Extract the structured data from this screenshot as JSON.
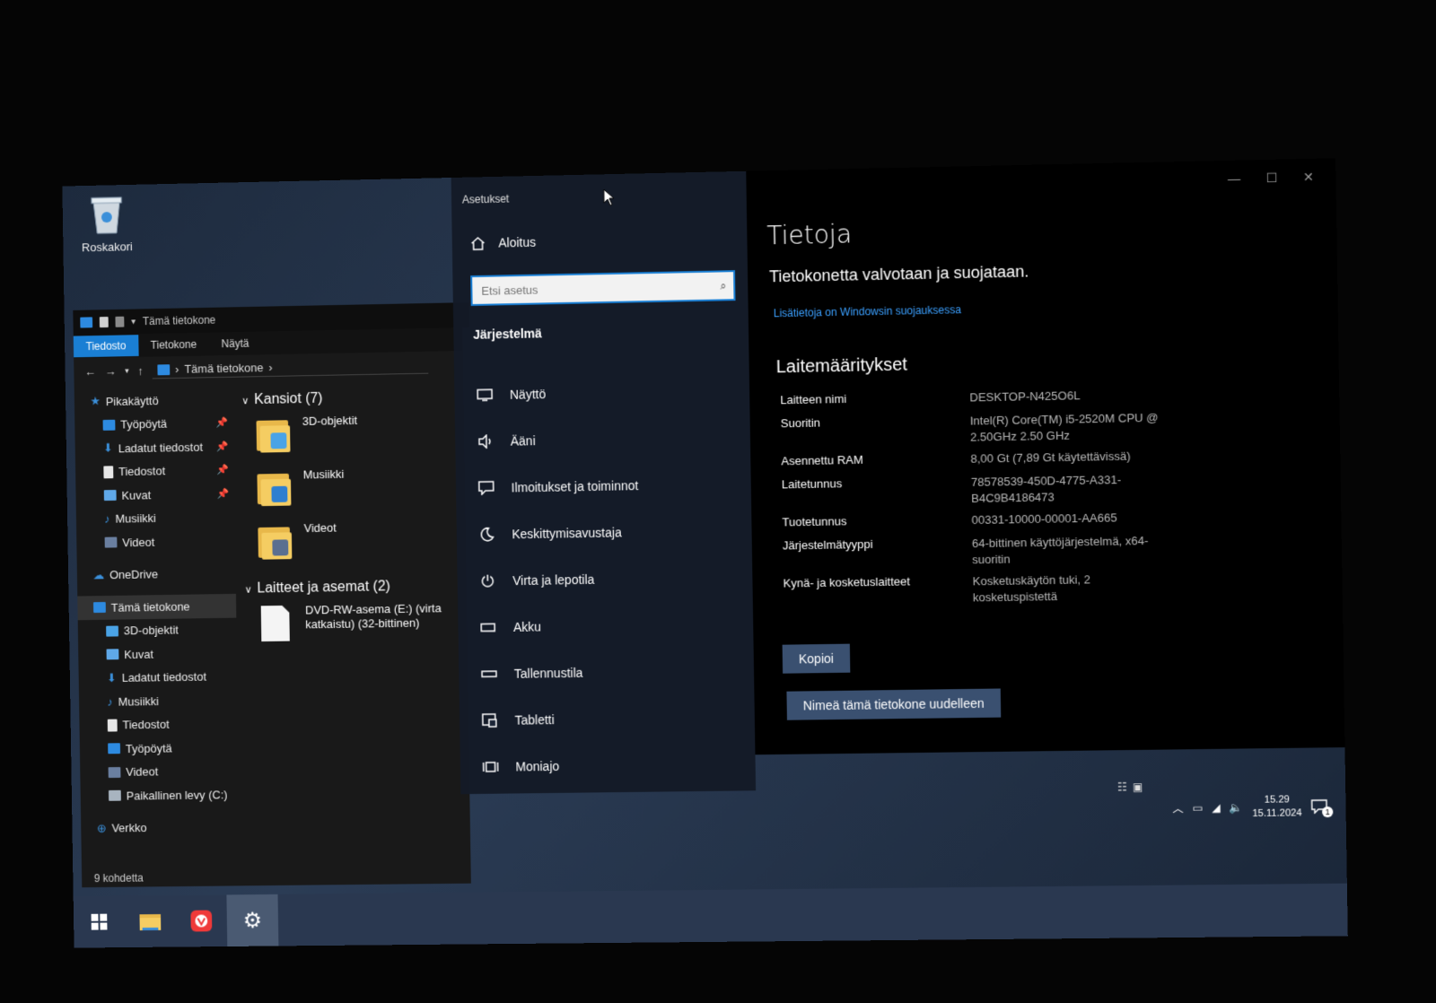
{
  "desktop": {
    "recycle_bin_label": "Roskakori"
  },
  "explorer": {
    "title": "Tämä tietokone",
    "ribbon_tabs": [
      "Tiedosto",
      "Tietokone",
      "Näytä"
    ],
    "address": "Tämä tietokone",
    "nav": {
      "quick_access": "Pikakäyttö",
      "pinned": [
        "Työpöytä",
        "Ladatut tiedostot",
        "Tiedostot",
        "Kuvat"
      ],
      "unpinned": [
        "Musiikki",
        "Videot"
      ],
      "onedrive": "OneDrive",
      "this_pc": "Tämä tietokone",
      "this_pc_items": [
        "3D-objektit",
        "Kuvat",
        "Ladatut tiedostot",
        "Musiikki",
        "Tiedostot",
        "Työpöytä",
        "Videot",
        "Paikallinen levy (C:)"
      ],
      "network": "Verkko"
    },
    "folders_header": "Kansiot (7)",
    "folders": [
      "3D-objektit",
      "Musiikki",
      "Videot"
    ],
    "devices_header": "Laitteet ja asemat (2)",
    "devices": [
      "DVD-RW-asema (E:) (virta katkaistu) (32-bittinen)"
    ],
    "status": "9 kohdetta"
  },
  "settings": {
    "window_title": "Asetukset",
    "home_label": "Aloitus",
    "search_placeholder": "Etsi asetus",
    "section": "Järjestelmä",
    "menu": [
      {
        "label": "Näyttö",
        "icon": "monitor-icon"
      },
      {
        "label": "Ääni",
        "icon": "speaker-icon"
      },
      {
        "label": "Ilmoitukset ja toiminnot",
        "icon": "notification-icon"
      },
      {
        "label": "Keskittymisavustaja",
        "icon": "moon-icon"
      },
      {
        "label": "Virta ja lepotila",
        "icon": "power-icon"
      },
      {
        "label": "Akku",
        "icon": "battery-icon"
      },
      {
        "label": "Tallennustila",
        "icon": "storage-icon"
      },
      {
        "label": "Tabletti",
        "icon": "tablet-icon"
      },
      {
        "label": "Moniajo",
        "icon": "multitask-icon"
      }
    ],
    "content": {
      "title": "Tietoja",
      "protection_text": "Tietokonetta valvotaan ja suojataan.",
      "security_link": "Lisätietoja on Windowsin suojauksessa",
      "specs_header": "Laitemääritykset",
      "specs": [
        {
          "key": "Laitteen nimi",
          "value": "DESKTOP-N425O6L"
        },
        {
          "key": "Suoritin",
          "value": "Intel(R) Core(TM) i5-2520M CPU @ 2.50GHz   2.50 GHz"
        },
        {
          "key": "Asennettu RAM",
          "value": "8,00 Gt (7,89 Gt käytettävissä)"
        },
        {
          "key": "Laitetunnus",
          "value": "78578539-450D-4775-A331-B4C9B4186473"
        },
        {
          "key": "Tuotetunnus",
          "value": "00331-10000-00001-AA665"
        },
        {
          "key": "Järjestelmätyyppi",
          "value": "64-bittinen käyttöjärjestelmä, x64-suoritin"
        },
        {
          "key": "Kynä- ja kosketuslaitteet",
          "value": "Kosketuskäytön tuki, 2 kosketuspistettä"
        }
      ],
      "copy_button": "Kopioi",
      "rename_button": "Nimeä tämä tietokone uudelleen"
    }
  },
  "taskbar": {
    "time": "15.29",
    "date": "15.11.2024",
    "notification_count": "1"
  },
  "colors": {
    "accent": "#1a7fd4",
    "link": "#3ba0ff",
    "button": "#3a5070"
  }
}
